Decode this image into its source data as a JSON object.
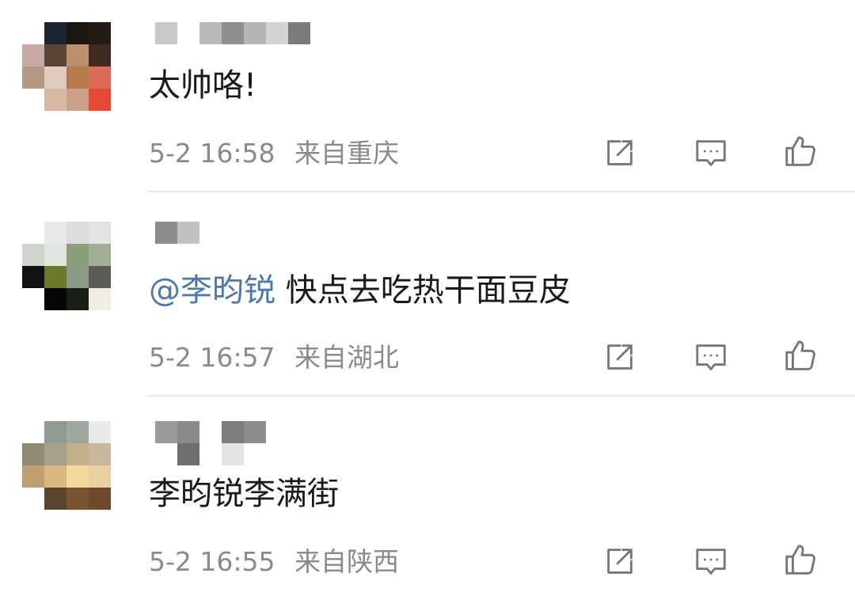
{
  "comments": [
    {
      "text": "太帅咯!",
      "mention": "",
      "date": "5-2",
      "time": "16:58",
      "location": "来自重庆"
    },
    {
      "text": "快点去吃热干面豆皮",
      "mention": "@李昀锐",
      "date": "5-2",
      "time": "16:57",
      "location": "来自湖北"
    },
    {
      "text": "李昀锐李满街",
      "mention": "",
      "date": "5-2",
      "time": "16:55",
      "location": "来自陕西"
    }
  ],
  "icons": {
    "share": "share-icon",
    "reply": "comment-icon",
    "like": "thumbs-up-icon"
  },
  "colors": {
    "text": "#1a1a1a",
    "meta": "#8a8a8a",
    "mention": "#4f7aa8",
    "divider": "#e9e9e9",
    "icon": "#777777"
  }
}
